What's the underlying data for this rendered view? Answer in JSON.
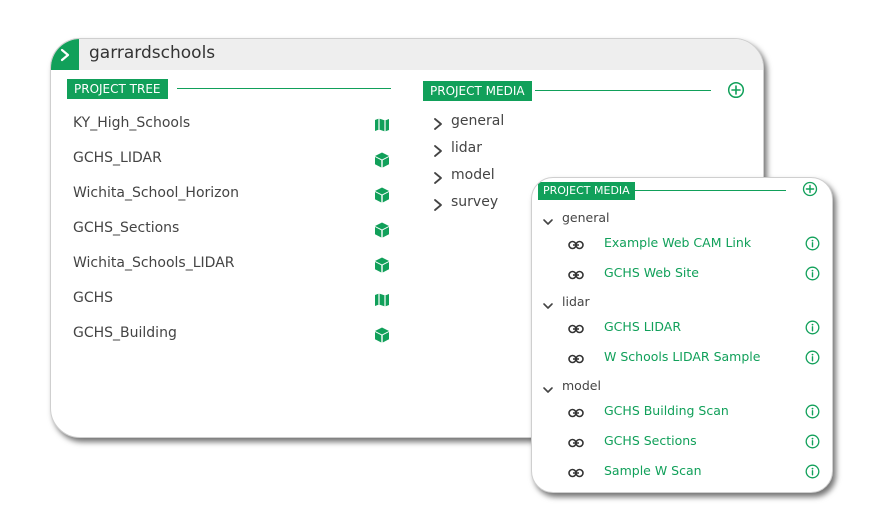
{
  "colors": {
    "accent": "#11a05a"
  },
  "project": {
    "title": "garrardschools",
    "toggle_icon": "chevron-right-icon"
  },
  "project_tree": {
    "heading": "PROJECT TREE",
    "items": [
      {
        "label": "KY_High_Schools",
        "icon": "map-icon"
      },
      {
        "label": "GCHS_LIDAR",
        "icon": "cube-icon"
      },
      {
        "label": "Wichita_School_Horizon",
        "icon": "cube-icon"
      },
      {
        "label": "GCHS_Sections",
        "icon": "cube-icon"
      },
      {
        "label": "Wichita_Schools_LIDAR",
        "icon": "cube-icon"
      },
      {
        "label": "GCHS",
        "icon": "map-icon"
      },
      {
        "label": "GCHS_Building",
        "icon": "cube-icon"
      }
    ]
  },
  "project_media": {
    "heading": "PROJECT MEDIA",
    "add_icon": "plus-circle-icon",
    "folders": [
      "general",
      "lidar",
      "model",
      "survey"
    ]
  },
  "media_popup": {
    "heading": "PROJECT MEDIA",
    "add_icon": "plus-circle-icon",
    "groups": [
      {
        "name": "general",
        "links": [
          "Example Web CAM Link",
          "GCHS Web Site"
        ]
      },
      {
        "name": "lidar",
        "links": [
          "GCHS LIDAR",
          "W Schools LIDAR Sample"
        ]
      },
      {
        "name": "model",
        "links": [
          "GCHS Building Scan",
          "GCHS Sections",
          "Sample W Scan"
        ]
      }
    ]
  }
}
